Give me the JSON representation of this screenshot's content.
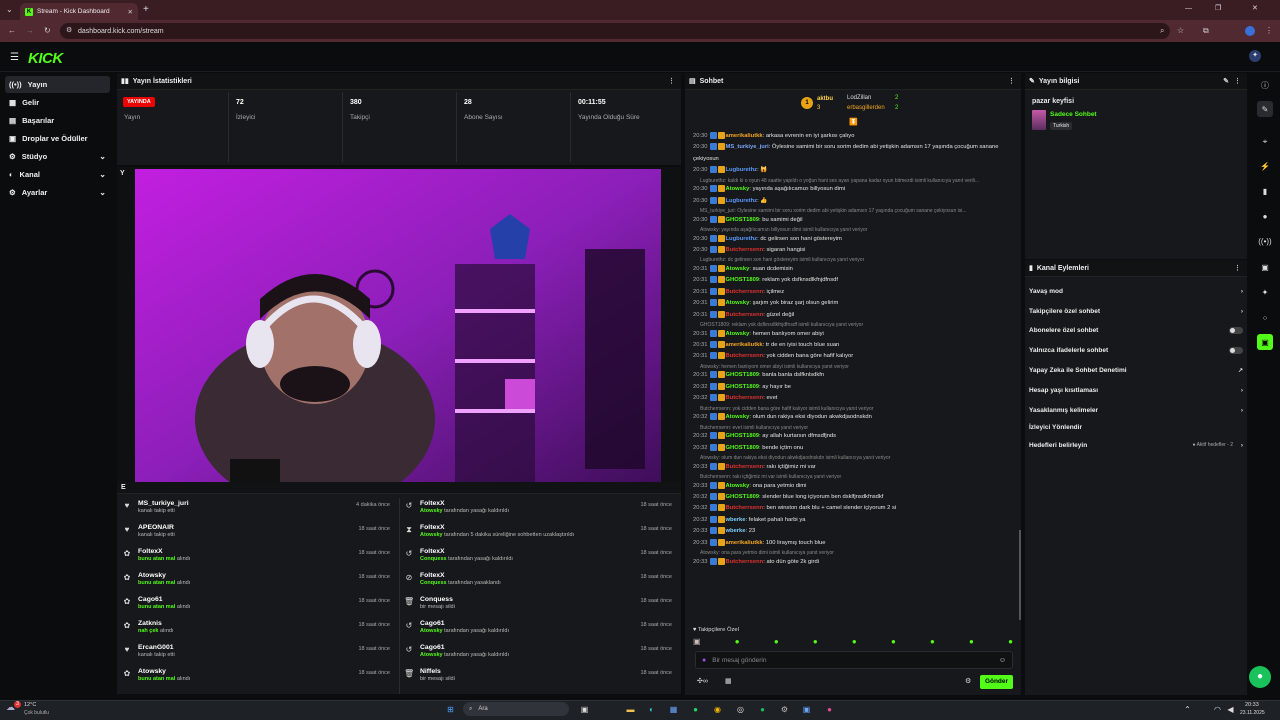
{
  "browser": {
    "tab_title": "Stream - Kick Dashboard",
    "new_tab": "+",
    "url": "dashboard.kick.com/stream"
  },
  "app": {
    "logo": "KICK"
  },
  "sidebar": {
    "items": [
      {
        "label": "Yayın",
        "icon": "broadcast-icon",
        "active": true
      },
      {
        "label": "Gelir",
        "icon": "revenue-icon"
      },
      {
        "label": "Başarılar",
        "icon": "achievements-icon"
      },
      {
        "label": "Droplar ve Ödüller",
        "icon": "drops-icon"
      },
      {
        "label": "Stüdyo",
        "icon": "studio-icon",
        "chevron": "⌄"
      },
      {
        "label": "Kanal",
        "icon": "channel-icon",
        "chevron": "⌄"
      },
      {
        "label": "Ayarlar",
        "icon": "settings-icon",
        "chevron": "⌄"
      }
    ]
  },
  "stats": {
    "title": "Yayın İstatistikleri",
    "live_badge": "YAYINDA",
    "live_label": "Yayın",
    "items": [
      {
        "value": "72",
        "label": "İzleyici"
      },
      {
        "value": "380",
        "label": "Takipçi"
      },
      {
        "value": "28",
        "label": "Abone Sayısı"
      },
      {
        "value": "00:11:55",
        "label": "Yayında Olduğu Süre"
      }
    ]
  },
  "activity_left": [
    {
      "name": "MS_turkiye_juri",
      "action": "kanalı takip etti",
      "time": "4 dakika önce",
      "icon": "heart-icon"
    },
    {
      "name": "APEONAIR",
      "action": "kanalı takip etti",
      "time": "18 saat önce",
      "icon": "heart-icon"
    },
    {
      "name": "FoltexX",
      "highlight": "bunu atan mal",
      "action": "alındı",
      "time": "18 saat önce",
      "icon": "reward-icon"
    },
    {
      "name": "Atowsky",
      "highlight": "bunu atan mal",
      "action": "alındı",
      "time": "18 saat önce",
      "icon": "reward-icon"
    },
    {
      "name": "Cago61",
      "highlight": "bunu atan mal",
      "action": "alındı",
      "time": "18 saat önce",
      "icon": "reward-icon"
    },
    {
      "name": "Zatknis",
      "highlight": "nah çek",
      "action": "alındı",
      "time": "18 saat önce",
      "icon": "reward-icon"
    },
    {
      "name": "ErcanG001",
      "action": "kanalı takip etti",
      "time": "18 saat önce",
      "icon": "heart-icon"
    },
    {
      "name": "Atowsky",
      "highlight": "bunu atan mal",
      "action": "alındı",
      "time": "18 saat önce",
      "icon": "reward-icon"
    }
  ],
  "activity_right": [
    {
      "name": "FoltexX",
      "highlight": "Atowsky",
      "action": "tarafından yasağı kaldırıldı",
      "time": "18 saat önce",
      "icon": "undo-icon"
    },
    {
      "name": "FoltexX",
      "highlight": "Atowsky",
      "action": "tarafından 5 dakika süreliğine sohbetten uzaklaştırıldı",
      "time": "18 saat önce",
      "icon": "hourglass-icon"
    },
    {
      "name": "FoltexX",
      "highlight": "Conquess",
      "action": "tarafından yasağı kaldırıldı",
      "time": "18 saat önce",
      "icon": "undo-icon"
    },
    {
      "name": "FoltexX",
      "highlight": "Conquess",
      "action": "tarafından yasaklandı",
      "time": "18 saat önce",
      "icon": "ban-icon"
    },
    {
      "name": "Conquess",
      "action": "bir mesajı sildi",
      "time": "18 saat önce",
      "icon": "trash-icon"
    },
    {
      "name": "Cago61",
      "highlight": "Atowsky",
      "action": "tarafından yasağı kaldırıldı",
      "time": "18 saat önce",
      "icon": "undo-icon"
    },
    {
      "name": "Cago61",
      "highlight": "Atowsky",
      "action": "tarafından yasağı kaldırıldı",
      "time": "18 saat önce",
      "icon": "undo-icon"
    },
    {
      "name": "Niffels",
      "action": "bir mesajı sildi",
      "time": "18 saat önce",
      "icon": "trash-icon"
    }
  ],
  "chat": {
    "title": "Sohbet",
    "top_gifters": [
      {
        "name": "aktbu",
        "count": "1"
      },
      {
        "name": "LodZillan",
        "count": "2"
      },
      {
        "name": "erbasgillerden",
        "count": "2"
      },
      {
        "rank": "3"
      }
    ],
    "lines": [
      {
        "t": "20:30",
        "u": "amerikaliutkk",
        "c": "#f5a623",
        "m": "arkasa evrenin en iyi şarkısı çalıyo"
      },
      {
        "t": "20:30",
        "u": "MS_turkiye_juri",
        "c": "#7aa7ff",
        "m": "Öylesine samimi bir soru sorim dedim abi yetişkin adamsın 17 yaşında çocuğum sanane"
      },
      {
        "t": "",
        "u": "",
        "c": "#fff",
        "m": "çekiyosun"
      },
      {
        "t": "20:30",
        "u": "Lugburethz",
        "c": "#5b9bff",
        "m": "🙀"
      },
      {
        "r": "Lugburethz: kaldı ki o oyun 48 saatte yapıldı o yoğun hani ses ayarı yapana kadar oyun bitmezdi isimli kullanıcıya yanıt verili..."
      },
      {
        "t": "20:30",
        "u": "Atowsky",
        "c": "#53fc18",
        "m": "yayında aşağılıcamızı billyosun dimi"
      },
      {
        "t": "20:30",
        "u": "Lugburethz",
        "c": "#5b9bff",
        "m": "👍"
      },
      {
        "r": "MS_turkiye_juri: Öylesine samimi bir soru sorim dedim abi yetişkin adamsın 17 yaşında çocuğum sanane çekiyosun isi..."
      },
      {
        "t": "20:30",
        "u": "GHOST1809",
        "c": "#53fc18",
        "m": "bu samimi değil"
      },
      {
        "r": "Atowsky: yayında aşağılıcamızı billyosun dimi isimli kullanıcıya yanıt veriyor"
      },
      {
        "t": "20:30",
        "u": "Lugburethz",
        "c": "#5b9bff",
        "m": "dc gelirsen son hani göstereyim"
      },
      {
        "t": "20:30",
        "u": "Butcherrsenn",
        "c": "#e0322f",
        "m": "sigaran hangisi"
      },
      {
        "r": "Lugburethz: dc gelirsen son hani göstereyim isimli kullanıcıya yanıt veriyor"
      },
      {
        "t": "20:31",
        "u": "Atowsky",
        "c": "#53fc18",
        "m": "suan dcdemisin"
      },
      {
        "t": "20:31",
        "u": "GHOST1809",
        "c": "#53fc18",
        "m": "reklam yok dsfknsdlkfnjdfnsdf"
      },
      {
        "t": "20:31",
        "u": "Butcherrsenn",
        "c": "#e0322f",
        "m": "içilmez"
      },
      {
        "t": "20:31",
        "u": "Atowsky",
        "c": "#53fc18",
        "m": "şarjım yok biraz şarj olsun gelirim"
      },
      {
        "t": "20:31",
        "u": "Butcherrsenn",
        "c": "#e0322f",
        "m": "güzel değil"
      },
      {
        "r": "GHOST1809: reklam yok dsfknsdlkfnjdfnsdf isimli kullanıcıya yanıt veriyor"
      },
      {
        "t": "20:31",
        "u": "Atowsky",
        "c": "#53fc18",
        "m": "hemen banlıyom omer abiyi"
      },
      {
        "t": "20:31",
        "u": "amerikaliutkk",
        "c": "#f5a623",
        "m": "tr de en iyisi touch blue suan"
      },
      {
        "t": "20:31",
        "u": "Butcherrsenn",
        "c": "#e0322f",
        "m": "yok cidden bana göre hafif kalıyor"
      },
      {
        "r": "Atowsky: hemen banlıyom omer abiyi isimli kullanıcıya yanıt veriyor"
      },
      {
        "t": "20:31",
        "u": "GHOST1809",
        "c": "#53fc18",
        "m": "banla banla dslfknlsdkfn"
      },
      {
        "t": "20:32",
        "u": "GHOST1809",
        "c": "#53fc18",
        "m": "ay hayır be"
      },
      {
        "t": "20:32",
        "u": "Butcherrsenn",
        "c": "#e0322f",
        "m": "evet"
      },
      {
        "r": "Butcherrsenn: yok cidden bana göre hafif kalıyor isimli kullanıcıya yanıt veriyor"
      },
      {
        "t": "20:32",
        "u": "Atowsky",
        "c": "#53fc18",
        "m": "olum dun rakiya eksi diyodun akwkdjaodnskdn"
      },
      {
        "r": "Butcherrsenn: evet isimli kullanıcıya yanıt veriyor"
      },
      {
        "t": "20:32",
        "u": "GHOST1809",
        "c": "#53fc18",
        "m": "ay allah kurtarsın dfmsdfjnds"
      },
      {
        "t": "20:32",
        "u": "GHOST1809",
        "c": "#53fc18",
        "m": "bende içtim onu"
      },
      {
        "r": "Atowsky: olum dun rakiya eksi diyodun akwkdjaodnskdn isimli kullanıcıya yanıt veriyor"
      },
      {
        "t": "20:33",
        "u": "Butcherrsenn",
        "c": "#e0322f",
        "m": "rakı içtiğimiz mi var"
      },
      {
        "r": "Butcherrsenn: rakı içtiğimiz mi var isimli kullanıcıya yanıt veriyor"
      },
      {
        "t": "20:33",
        "u": "Atowsky",
        "c": "#53fc18",
        "m": "ona para yetmio dimi"
      },
      {
        "t": "20:32",
        "u": "GHOST1809",
        "c": "#53fc18",
        "m": "slender blue long içiyorum ben dsklfjnsdkfnsdkf"
      },
      {
        "t": "20:32",
        "u": "Butcherrsenn",
        "c": "#e0322f",
        "m": "ben winston dark blu + camel slender içiyorum 2 si"
      },
      {
        "t": "20:32",
        "u": "wberke",
        "c": "#7ad0ff",
        "m": "felaket pahalı harbi ya"
      },
      {
        "t": "20:33",
        "u": "wberke",
        "c": "#7ad0ff",
        "m": "23"
      },
      {
        "t": "20:33",
        "u": "amerikaliutkk",
        "c": "#f5a623",
        "m": "100 liraymış touch blue"
      },
      {
        "r": "Atowsky: ona para yetmio dimi isimli kullanıcıya yanıt veriyor"
      },
      {
        "t": "20:33",
        "u": "Butcherrsenn",
        "c": "#e0322f",
        "m": "ato dün göte 2k girdi"
      }
    ],
    "mode_label": "Takipçilere Özel",
    "input_placeholder": "Bir mesaj gönderin",
    "send_label": "Gönder",
    "pause_icon": "⏬"
  },
  "stream_info": {
    "title": "Yayın bilgisi",
    "stream_title": "pazar keyfisi",
    "category": "Sadece Sohbet",
    "language": "Turkish"
  },
  "channel_actions": {
    "title": "Kanal Eylemleri",
    "items": [
      {
        "label": "Yavaş mod",
        "control": "chevron"
      },
      {
        "label": "Takipçilere özel sohbet",
        "control": "chevron"
      },
      {
        "label": "Abonelere özel sohbet",
        "control": "toggle"
      },
      {
        "label": "Yalnızca ifadelerle sohbet",
        "control": "toggle"
      },
      {
        "label": "Yapay Zeka ile Sohbet Denetimi",
        "control": "external"
      },
      {
        "label": "Hesap yaşı kısıtlaması",
        "control": "chevron"
      },
      {
        "label": "Yasaklanmış kelimeler",
        "control": "chevron"
      },
      {
        "label": "İzleyici Yönlendir",
        "control": "none"
      },
      {
        "label": "Hedefleri belirleyin",
        "control": "chevron",
        "extra": "Aktif hedefler - 2"
      }
    ]
  },
  "taskbar": {
    "weather_temp": "12°C",
    "weather_desc": "Çok bulutlu",
    "search_placeholder": "Ara",
    "time": "20:33",
    "date": "23.11.2025",
    "notification_count": "3"
  },
  "colors": {
    "accent": "#53fc18",
    "live": "#eb0400",
    "panel": "#17181b",
    "bg": "#0b0c0e"
  }
}
